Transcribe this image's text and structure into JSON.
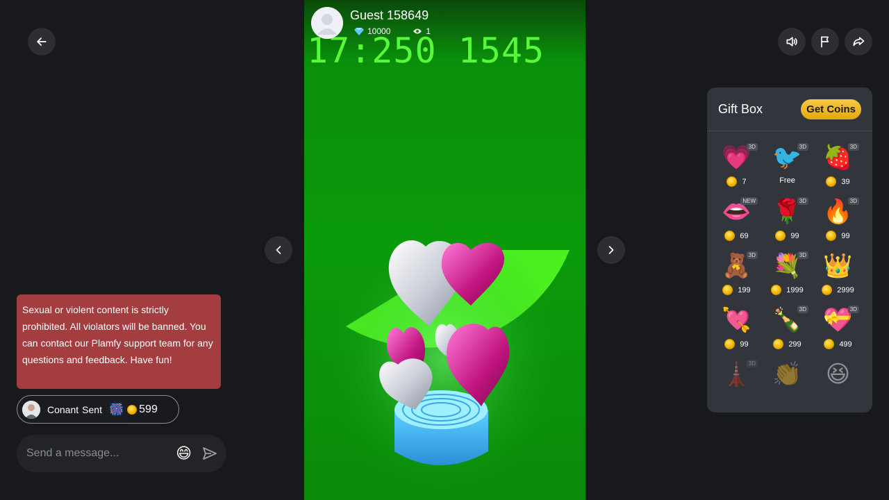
{
  "nav": {
    "back": "back-arrow"
  },
  "stream": {
    "clock_text": "17:250 1545",
    "host_name": "Guest 158649",
    "diamonds": "10000",
    "viewers": "1"
  },
  "chat": {
    "notice": "Sexual or violent content is strictly prohibited. All violators will be banned. You can contact our Plamfy support team for any questions and feedback. Have fun!",
    "gift_event": {
      "user": "Conant",
      "action": "Sent",
      "amount": "599"
    },
    "placeholder": "Send a message..."
  },
  "giftbox": {
    "title": "Gift Box",
    "get_coins": "Get Coins",
    "items": [
      {
        "name": "follow-me-heart",
        "emoji": "💗",
        "price": "7",
        "badge": "3D"
      },
      {
        "name": "hi-bird",
        "emoji": "🐦",
        "price": "Free",
        "badge": "3D"
      },
      {
        "name": "strawberry",
        "emoji": "🍓",
        "price": "39",
        "badge": "3D"
      },
      {
        "name": "lips",
        "emoji": "👄",
        "price": "69",
        "badge": "NEW"
      },
      {
        "name": "rose",
        "emoji": "🌹",
        "price": "99",
        "badge": "3D"
      },
      {
        "name": "fire",
        "emoji": "🔥",
        "price": "99",
        "badge": "3D"
      },
      {
        "name": "teddy-bear",
        "emoji": "🧸",
        "price": "199",
        "badge": "3D"
      },
      {
        "name": "bouquet",
        "emoji": "💐",
        "price": "1999",
        "badge": "3D"
      },
      {
        "name": "tiara",
        "emoji": "👑",
        "price": "2999",
        "badge": ""
      },
      {
        "name": "heart-arrow",
        "emoji": "💘",
        "price": "99",
        "badge": ""
      },
      {
        "name": "champagne",
        "emoji": "🍾",
        "price": "299",
        "badge": "3D"
      },
      {
        "name": "heart-box",
        "emoji": "💝",
        "price": "499",
        "badge": "3D"
      },
      {
        "name": "tower",
        "emoji": "🗼",
        "price": "",
        "badge": "3D"
      },
      {
        "name": "clap",
        "emoji": "👏",
        "price": "",
        "badge": ""
      },
      {
        "name": "laugh",
        "emoji": "😆",
        "price": "",
        "badge": ""
      }
    ]
  }
}
